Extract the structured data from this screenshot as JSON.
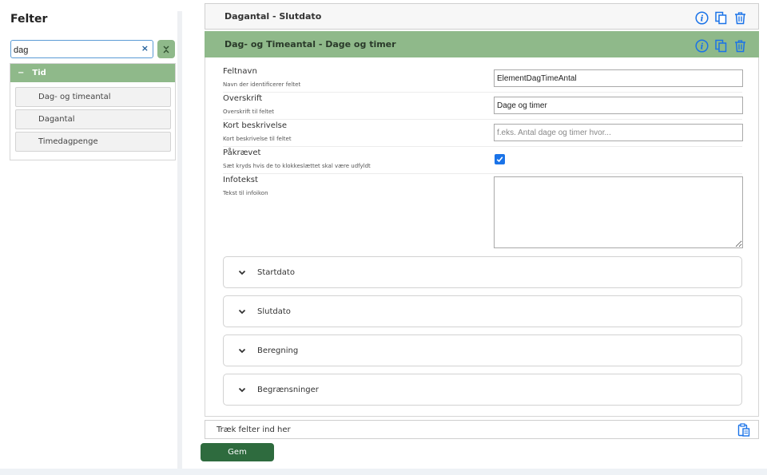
{
  "sidebar": {
    "title": "Felter",
    "search": {
      "value": "dag",
      "clear_icon": "×"
    },
    "collapse_icon": "chevrons-collapse-icon",
    "group": {
      "toggle": "−",
      "label": "Tid"
    },
    "items": [
      {
        "label": "Dag- og timeantal"
      },
      {
        "label": "Dagantal"
      },
      {
        "label": "Timedagpenge"
      }
    ]
  },
  "panels": [
    {
      "title": "Dagantal - Slutdato",
      "state": "collapsed"
    },
    {
      "title": "Dag- og Timeantal - Dage og timer",
      "state": "expanded"
    }
  ],
  "form": {
    "rows": [
      {
        "label": "Feltnavn",
        "sub": "Navn der identificerer feltet",
        "value": "ElementDagTimeAntal",
        "placeholder": ""
      },
      {
        "label": "Overskrift",
        "sub": "Overskrift til feltet",
        "value": "Dage og timer",
        "placeholder": ""
      },
      {
        "label": "Kort beskrivelse",
        "sub": "Kort beskrivelse til feltet",
        "value": "",
        "placeholder": "f.eks. Antal dage og timer hvor..."
      },
      {
        "label": "Påkrævet",
        "sub": "Sæt kryds hvis de to klokkeslættet skal være udfyldt",
        "checked": true
      },
      {
        "label": "Infotekst",
        "sub": "Tekst til infoikon",
        "value": ""
      }
    ],
    "sections": [
      {
        "label": "Startdato"
      },
      {
        "label": "Slutdato"
      },
      {
        "label": "Beregning"
      },
      {
        "label": "Begrænsninger"
      }
    ]
  },
  "drop_zone": {
    "label": "Træk felter ind her"
  },
  "save_button": {
    "label": "Gem"
  },
  "colors": {
    "accent_green": "#8fb98a",
    "save_green": "#2e6b3e",
    "icon_blue": "#1a73e8"
  }
}
